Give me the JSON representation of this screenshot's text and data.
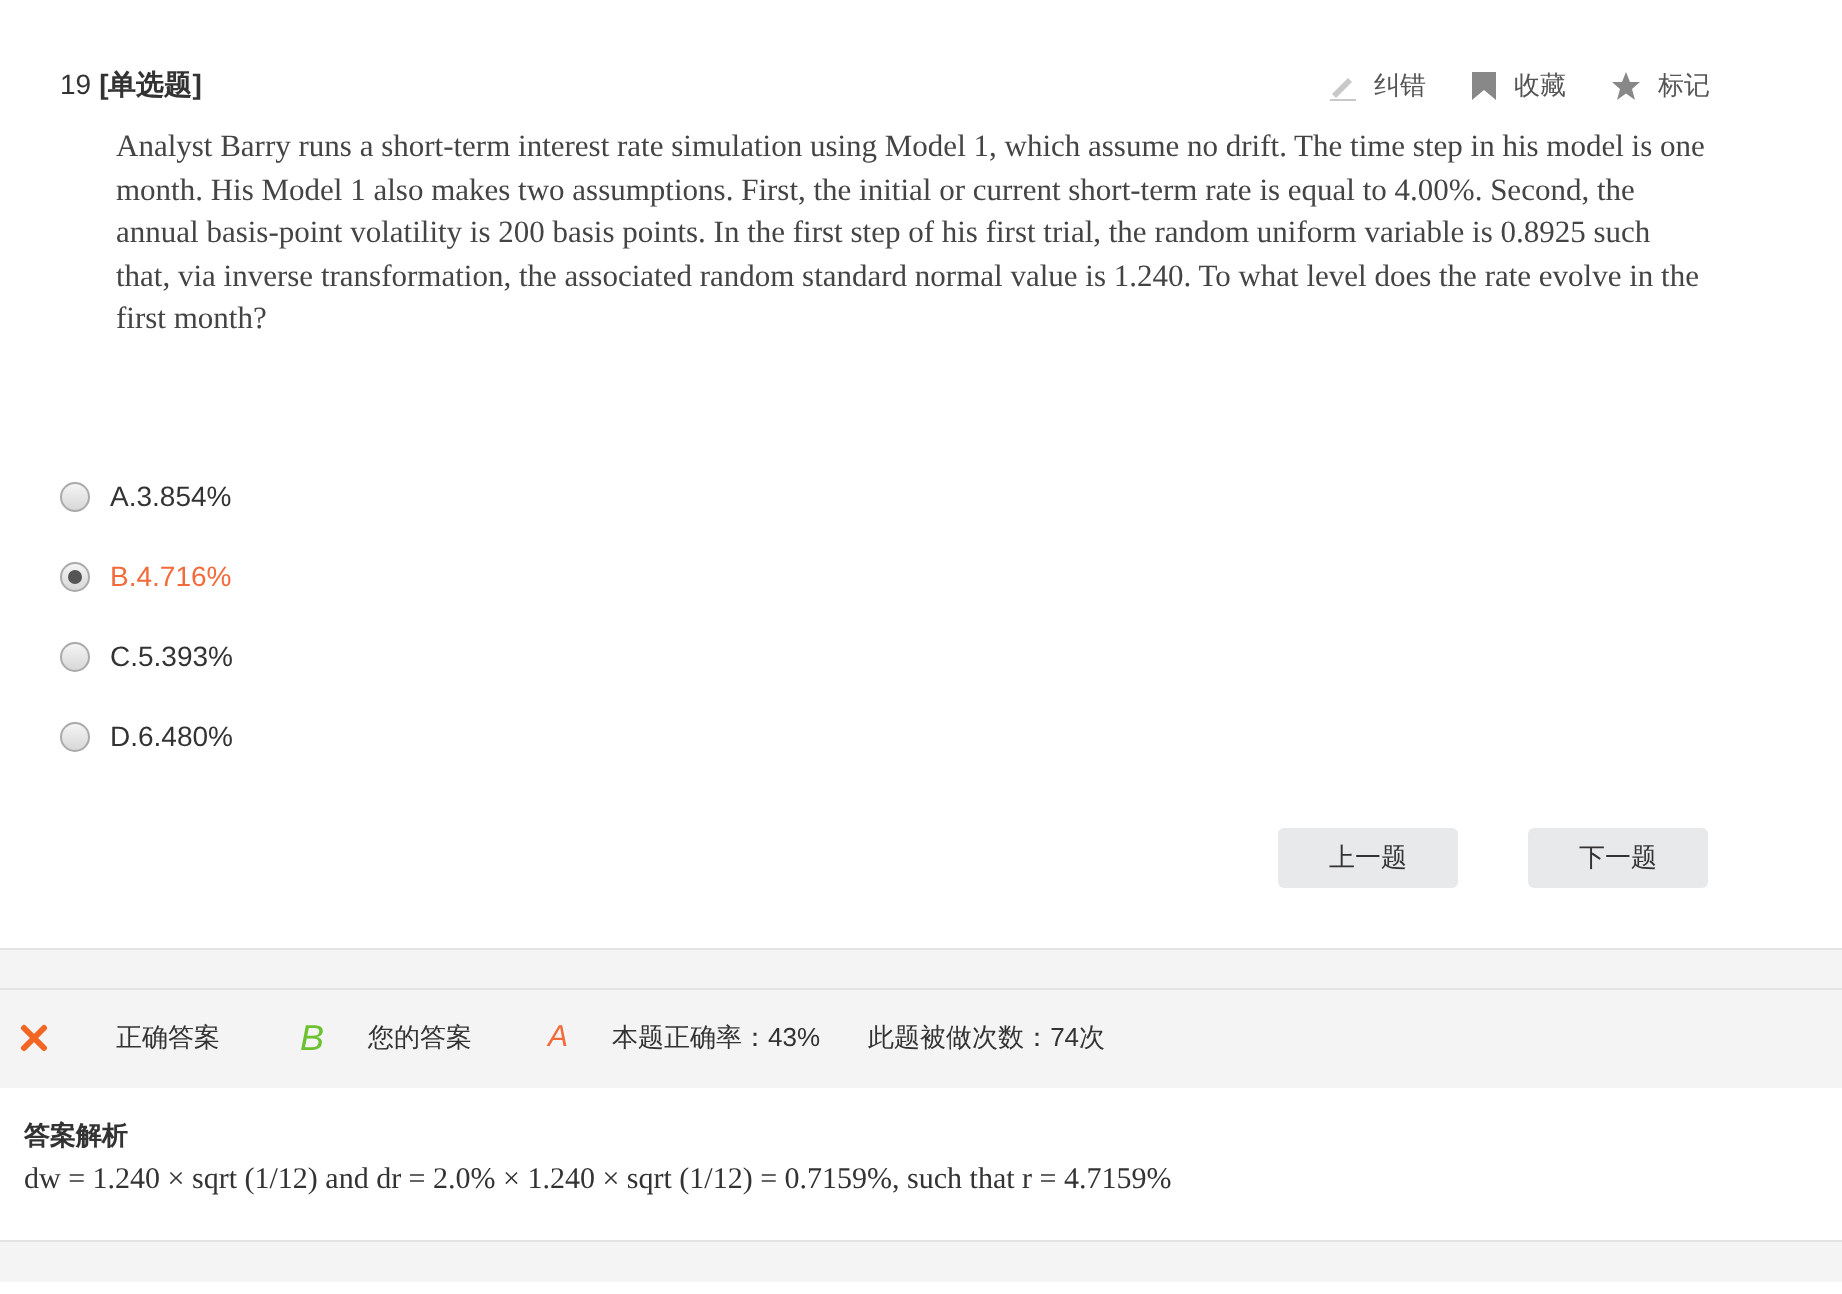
{
  "question": {
    "number": "19",
    "type": "[单选题]",
    "text": "Analyst Barry runs a short-term interest rate simulation using Model 1, which assume no drift. The time step in his model is one month. His Model 1 also makes two assumptions. First, the initial or current short-term rate is equal to 4.00%. Second, the annual basis-point volatility is 200 basis points. In the first step of his first trial, the random uniform variable is 0.8925 such that, via inverse transformation, the associated random standard normal value is 1.240. To what level does the rate evolve in the first month?"
  },
  "actions": [
    {
      "kind": "pencil",
      "label": "纠错"
    },
    {
      "kind": "bookmark",
      "label": "收藏"
    },
    {
      "kind": "star",
      "label": "标记"
    }
  ],
  "options": [
    {
      "label": "A.3.854%",
      "selected": false
    },
    {
      "label": "B.4.716%",
      "selected": true
    },
    {
      "label": "C.5.393%",
      "selected": false
    },
    {
      "label": "D.6.480%",
      "selected": false
    }
  ],
  "nav_buttons": [
    "上一题",
    "下一题"
  ],
  "result": {
    "correct_label": "正确答案",
    "correct_value": "B",
    "your_label": "您的答案",
    "your_value": "A",
    "rate": "本题正确率：43%",
    "count": "此题被做次数：74次"
  },
  "analysis": {
    "title": "答案解析",
    "text": "dw = 1.240 × sqrt (1/12) and dr = 2.0% × 1.240 × sqrt (1/12) = 0.7159%, such that r = 4.7159%"
  }
}
